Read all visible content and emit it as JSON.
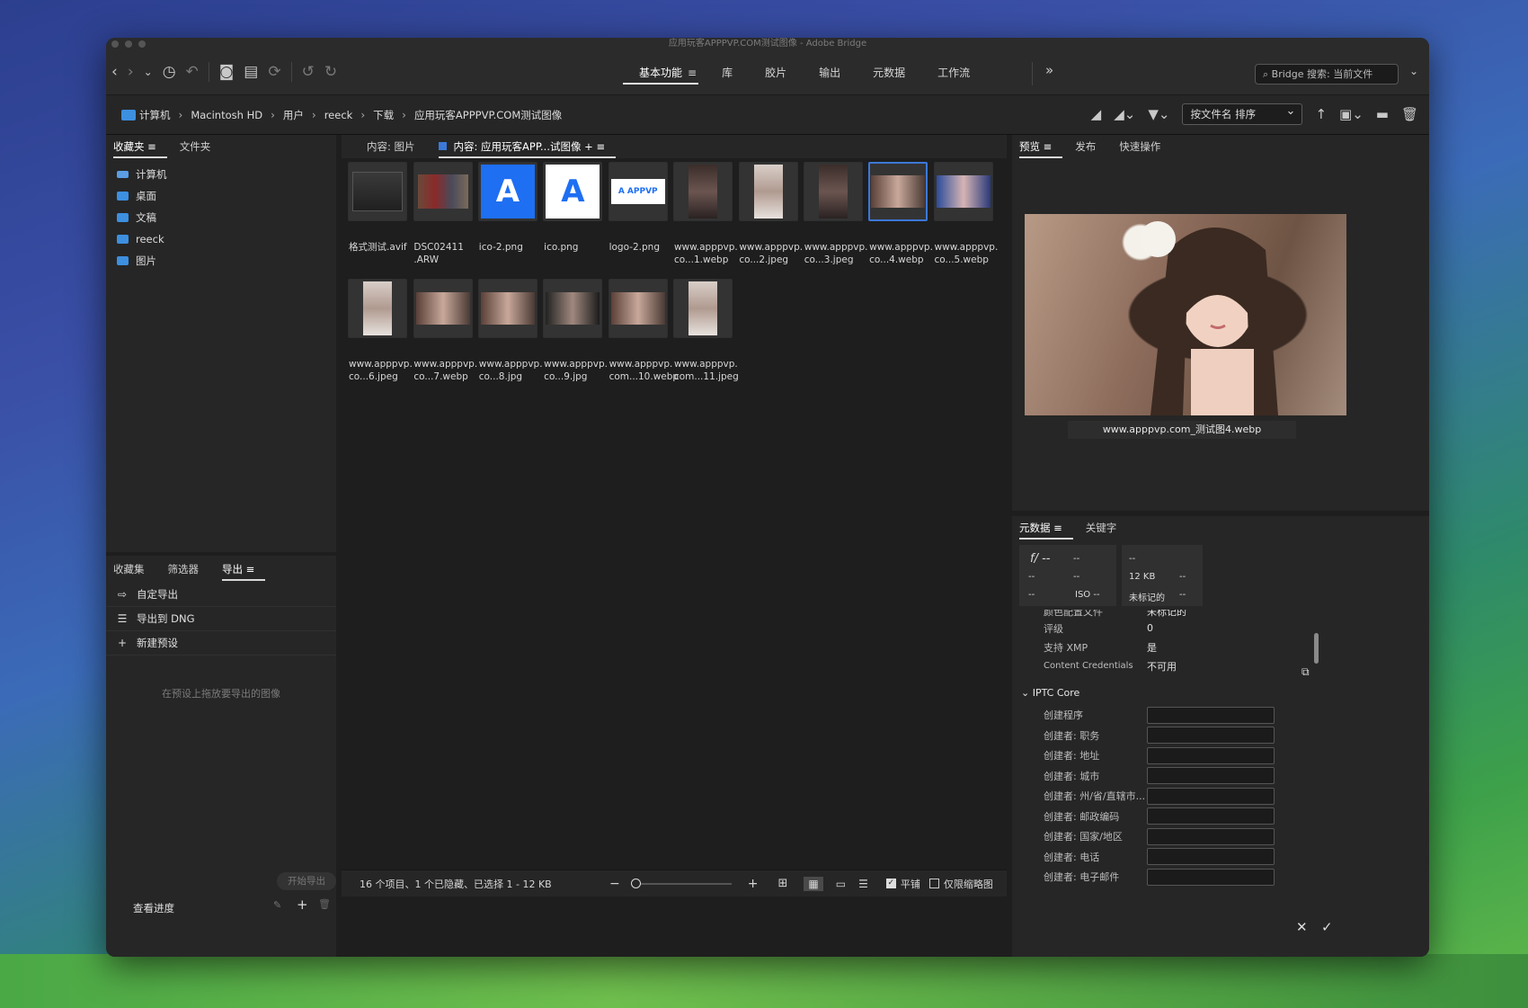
{
  "window": {
    "title": "应用玩客APPPVP.COM测试图像 - Adobe Bridge"
  },
  "toolbar": {
    "workspaces": [
      {
        "label": "基本功能",
        "active": true
      },
      {
        "label": "库"
      },
      {
        "label": "胶片"
      },
      {
        "label": "输出"
      },
      {
        "label": "元数据"
      },
      {
        "label": "工作流"
      }
    ],
    "more_label": "»",
    "search_placeholder": "Bridge 搜索: 当前文件"
  },
  "path": {
    "crumbs": [
      "计算机",
      "Macintosh HD",
      "用户",
      "reeck",
      "下载",
      "应用玩客APPPVP.COM测试图像"
    ],
    "sort_label": "按文件名 排序"
  },
  "left_top": {
    "tabs": [
      "收藏夹",
      "文件夹"
    ],
    "items": [
      "计算机",
      "桌面",
      "文稿",
      "reeck",
      "图片"
    ]
  },
  "left_bottom": {
    "tabs": [
      "收藏集",
      "筛选器",
      "导出"
    ],
    "items": [
      "自定导出",
      "导出到 DNG",
      "新建预设"
    ],
    "drop_hint": "在预设上拖放要导出的图像",
    "start_button": "开始导出",
    "progress_label": "查看进度"
  },
  "content": {
    "tabs": [
      "内容: 图片",
      "内容: 应用玩客APP...试图像"
    ],
    "files": [
      {
        "name": "格式测试.avif",
        "kind": "dark"
      },
      {
        "name": "DSC02411\n.ARW",
        "kind": "group"
      },
      {
        "name": "ico-2.png",
        "kind": "logo-blue"
      },
      {
        "name": "ico.png",
        "kind": "logo-white"
      },
      {
        "name": "logo-2.png",
        "kind": "wordmark"
      },
      {
        "name": "www.apppvp.\nco...1.webp",
        "kind": "portrait"
      },
      {
        "name": "www.apppvp.\nco...2.jpeg",
        "kind": "portrait-light"
      },
      {
        "name": "www.apppvp.\nco...3.jpeg",
        "kind": "portrait"
      },
      {
        "name": "www.apppvp.\nco...4.webp",
        "kind": "landscape",
        "selected": true
      },
      {
        "name": "www.apppvp.\nco...5.webp",
        "kind": "landscape-blue"
      },
      {
        "name": "www.apppvp.\nco...6.jpeg",
        "kind": "portrait-light"
      },
      {
        "name": "www.apppvp.\nco...7.webp",
        "kind": "landscape"
      },
      {
        "name": "www.apppvp.\nco...8.jpg",
        "kind": "landscape"
      },
      {
        "name": "www.apppvp.\nco...9.jpg",
        "kind": "landscape-dark"
      },
      {
        "name": "www.apppvp.\ncom...10.webp",
        "kind": "landscape"
      },
      {
        "name": "www.apppvp.\ncom...11.jpeg",
        "kind": "portrait-light"
      }
    ],
    "status_text": "16 个项目、1 个已隐藏、已选择 1 - 12 KB",
    "tile_label": "平铺",
    "thumb_only_label": "仅限缩略图"
  },
  "preview": {
    "tabs": [
      "预览",
      "发布",
      "快速操作"
    ],
    "caption": "www.apppvp.com_测试图4.webp"
  },
  "metadata": {
    "tabs": [
      "元数据",
      "关键字"
    ],
    "camera": {
      "aperture": "f/ --",
      "shutter": "--",
      "iso": "ISO --",
      "c1": "--",
      "c2": "--",
      "c3": "--",
      "c4": "--",
      "size": "12 KB",
      "c5": "--",
      "c6": "--",
      "label_state": "未标记的",
      "c7": "--"
    },
    "rows": [
      {
        "k": "颜色配置文件",
        "v": "未标记的"
      },
      {
        "k": "评级",
        "v": "0"
      },
      {
        "k": "支持 XMP",
        "v": "是"
      },
      {
        "k": "Content Credentials",
        "v": "不可用"
      }
    ],
    "iptc_title": "IPTC Core",
    "iptc_fields": [
      "创建程序",
      "创建者: 职务",
      "创建者: 地址",
      "创建者: 城市",
      "创建者: 州/省/直辖市...",
      "创建者: 邮政编码",
      "创建者: 国家/地区",
      "创建者: 电话",
      "创建者: 电子邮件"
    ]
  }
}
